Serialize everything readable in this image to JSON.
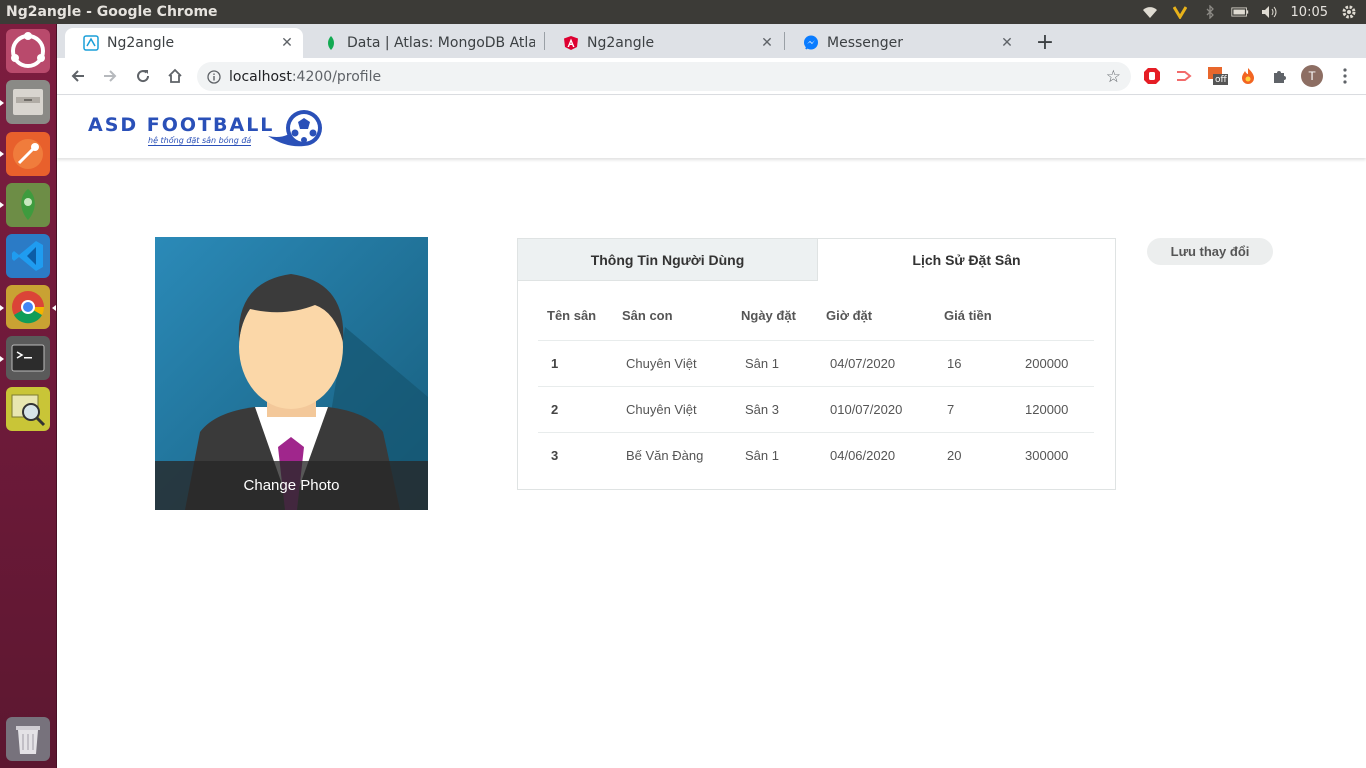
{
  "os": {
    "window_title": "Ng2angle - Google Chrome",
    "clock": "10:05"
  },
  "browser": {
    "tabs": [
      {
        "label": "Ng2angle",
        "active": true
      },
      {
        "label": "Data | Atlas: MongoDB Atlas",
        "active": false
      },
      {
        "label": "Ng2angle",
        "active": false
      },
      {
        "label": "Messenger",
        "active": false
      }
    ],
    "url_host": "localhost",
    "url_path": ":4200/profile",
    "profile_initial": "T",
    "ext_badge": "off"
  },
  "site": {
    "brand_name": "ASD FOOTBALL",
    "brand_tagline": "hệ thống đặt sân bóng đá"
  },
  "profile": {
    "change_photo_label": "Change Photo",
    "tabs": [
      "Thông Tin Người Dùng",
      "Lịch Sử Đặt Sân"
    ],
    "active_tab": 1,
    "save_label": "Lưu thay đổi",
    "table": {
      "headers": [
        "Tên sân",
        "Sân con",
        "Ngày đặt",
        "Giờ đặt",
        "Giá tiền"
      ],
      "rows": [
        {
          "id": "1",
          "owner": "Chuyên Việt",
          "sub": "Sân 1",
          "date": "04/07/2020",
          "hour": "16",
          "price": "200000"
        },
        {
          "id": "2",
          "owner": "Chuyên Việt",
          "sub": "Sân 3",
          "date": "010/07/2020",
          "hour": "7",
          "price": "120000"
        },
        {
          "id": "3",
          "owner": "Bế Văn Đàng",
          "sub": "Sân 1",
          "date": "04/06/2020",
          "hour": "20",
          "price": "300000"
        }
      ]
    }
  },
  "colors": {
    "brand": "#2a50b8",
    "launcher": "#7d1d3f",
    "os_panel": "#3c3b37",
    "photo_bg": "#1e6f93"
  },
  "icons": {
    "launcher": [
      "ubuntu-dash-icon",
      "files-icon",
      "postman-icon",
      "robo3t-icon",
      "vscode-icon",
      "chrome-icon",
      "terminal-icon",
      "image-viewer-icon",
      "trash-icon"
    ]
  }
}
